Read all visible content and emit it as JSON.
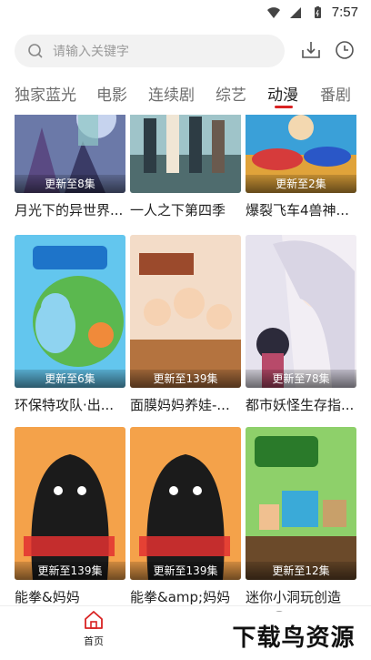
{
  "status_bar": {
    "time": "7:57"
  },
  "search": {
    "placeholder": "请输入关键字"
  },
  "tabs": [
    {
      "label": "独家蓝光",
      "active": false
    },
    {
      "label": "电影",
      "active": false
    },
    {
      "label": "连续剧",
      "active": false
    },
    {
      "label": "综艺",
      "active": false
    },
    {
      "label": "动漫",
      "active": true
    },
    {
      "label": "番剧",
      "active": false
    }
  ],
  "accent_color": "#d92222",
  "items": [
    {
      "title": "月光下的异世界...",
      "badge": "更新至8集"
    },
    {
      "title": "一人之下第四季",
      "badge": ""
    },
    {
      "title": "爆裂飞车4兽神...",
      "badge": "更新至2集"
    },
    {
      "title": "环保特攻队·出...",
      "badge": "更新至6集"
    },
    {
      "title": "面膜妈妈养娃-...",
      "badge": "更新至139集"
    },
    {
      "title": "都市妖怪生存指...",
      "badge": "更新至78集"
    },
    {
      "title": "能拳&妈妈",
      "badge": "更新至139集"
    },
    {
      "title": "能拳&amp;妈妈",
      "badge": "更新至139集"
    },
    {
      "title": "迷你小洞玩创造",
      "badge": "更新至12集"
    }
  ],
  "bottom_nav": {
    "home_label": "首页"
  },
  "watermark": "下载鸟资源",
  "icons": {
    "search": "search-icon",
    "download": "download-icon",
    "history": "clock-icon",
    "home": "home-icon"
  }
}
